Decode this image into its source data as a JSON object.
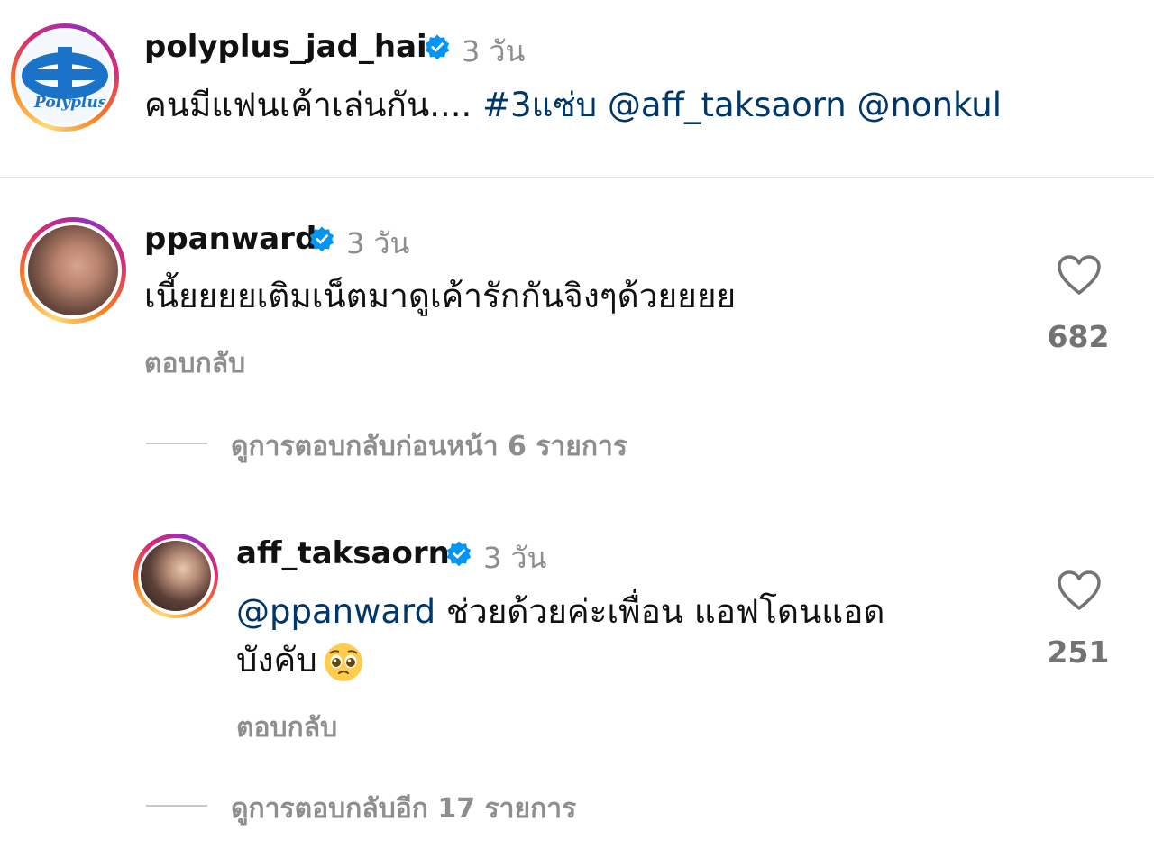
{
  "post": {
    "username": "polyplus_jad_hai",
    "time": "3 วัน",
    "caption_text": "คนมีแฟนเค้าเล่นกัน....",
    "hashtag": "#3แซ่บ",
    "mention1": "@aff_taksaorn",
    "mention2": "@nonkul",
    "logo_text": "Polyplus"
  },
  "comments": [
    {
      "username": "ppanward",
      "time": "3 วัน",
      "text": "เนี้ยยยยเติมเน็ตมาดูเค้ารักกันจิงๆด้วยยยย",
      "reply_label": "ตอบกลับ",
      "likes": "682"
    }
  ],
  "view_prev_replies": "ดูการตอบกลับก่อนหน้า 6 รายการ",
  "reply": {
    "username": "aff_taksaorn",
    "time": "3 วัน",
    "mention": "@ppanward",
    "text_line1": " ช่วยด้วยค่ะเพื่อน แอฟโดนแอด",
    "text_line2": "บังคับ",
    "emoji": "🥺",
    "reply_label": "ตอบกลับ",
    "likes": "251"
  },
  "view_more_replies": "ดูการตอบกลับอีก 17 รายการ",
  "colors": {
    "link": "#00376b",
    "verified": "#0095f6",
    "muted": "#8e8e8e"
  }
}
